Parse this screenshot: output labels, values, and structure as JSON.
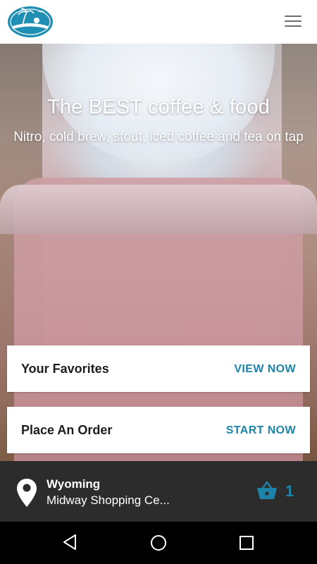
{
  "header": {
    "logo": "beach-palm-logo",
    "menu_icon": "hamburger-menu-icon"
  },
  "hero": {
    "title": "The BEST coffee & food",
    "subtitle": "Nitro, cold brew, stout, iced coffee and tea on tap"
  },
  "cards": {
    "favorites": {
      "label": "Your Favorites",
      "action": "VIEW NOW"
    },
    "order": {
      "label": "Place An Order",
      "action": "START NOW"
    }
  },
  "location": {
    "name": "Wyoming",
    "address": "Midway Shopping Ce...",
    "pin_icon": "location-pin-icon"
  },
  "cart": {
    "count": "1",
    "icon": "basket-icon"
  },
  "colors": {
    "accent": "#1e83a8",
    "location_bar": "#2c2c2c",
    "logo_blue": "#1f8fb3"
  },
  "navbar": {
    "back_icon": "back-triangle-icon",
    "home_icon": "home-circle-icon",
    "recent_icon": "recent-apps-square-icon"
  }
}
